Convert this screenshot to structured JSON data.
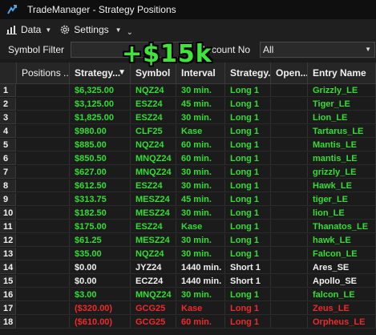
{
  "window": {
    "title": "TradeManager - Strategy Positions"
  },
  "toolbar": {
    "data_label": "Data",
    "settings_label": "Settings"
  },
  "filter": {
    "symbol_label": "Symbol Filter",
    "symbol_value": "",
    "account_label": "Account No",
    "account_value": "All"
  },
  "overlay": {
    "text": "+$15k"
  },
  "columns": [
    "Positions ...",
    "Strategy...",
    "Symbol",
    "Interval",
    "Strategy...",
    "Open...",
    "Entry Name"
  ],
  "colors": {
    "profit": "#33dd33",
    "neutral": "#f0f0f0",
    "loss": "#ee2a2a"
  },
  "rows": [
    {
      "num": "1",
      "pnl": "$6,325.00",
      "symbol": "NQZ24",
      "interval": "30 min.",
      "strategy": "Long 1",
      "open": "",
      "entry": "Grizzly_LE",
      "status": "green"
    },
    {
      "num": "2",
      "pnl": "$3,125.00",
      "symbol": "ESZ24",
      "interval": "45 min.",
      "strategy": "Long 1",
      "open": "",
      "entry": "Tiger_LE",
      "status": "green"
    },
    {
      "num": "3",
      "pnl": "$1,825.00",
      "symbol": "ESZ24",
      "interval": "30 min.",
      "strategy": "Long 1",
      "open": "",
      "entry": "Lion_LE",
      "status": "green"
    },
    {
      "num": "4",
      "pnl": "$980.00",
      "symbol": "CLF25",
      "interval": "Kase",
      "strategy": "Long 1",
      "open": "",
      "entry": "Tartarus_LE",
      "status": "green"
    },
    {
      "num": "5",
      "pnl": "$885.00",
      "symbol": "NQZ24",
      "interval": "60 min.",
      "strategy": "Long 1",
      "open": "",
      "entry": "Mantis_LE",
      "status": "green"
    },
    {
      "num": "6",
      "pnl": "$850.50",
      "symbol": "MNQZ24",
      "interval": "60 min.",
      "strategy": "Long 1",
      "open": "",
      "entry": "mantis_LE",
      "status": "green"
    },
    {
      "num": "7",
      "pnl": "$627.00",
      "symbol": "MNQZ24",
      "interval": "30 min.",
      "strategy": "Long 1",
      "open": "",
      "entry": "grizzly_LE",
      "status": "green"
    },
    {
      "num": "8",
      "pnl": "$612.50",
      "symbol": "ESZ24",
      "interval": "30 min.",
      "strategy": "Long 1",
      "open": "",
      "entry": "Hawk_LE",
      "status": "green"
    },
    {
      "num": "9",
      "pnl": "$313.75",
      "symbol": "MESZ24",
      "interval": "45 min.",
      "strategy": "Long 1",
      "open": "",
      "entry": "tiger_LE",
      "status": "green"
    },
    {
      "num": "10",
      "pnl": "$182.50",
      "symbol": "MESZ24",
      "interval": "30 min.",
      "strategy": "Long 1",
      "open": "",
      "entry": "lion_LE",
      "status": "green"
    },
    {
      "num": "11",
      "pnl": "$175.00",
      "symbol": "ESZ24",
      "interval": "Kase",
      "strategy": "Long 1",
      "open": "",
      "entry": "Thanatos_LE",
      "status": "green"
    },
    {
      "num": "12",
      "pnl": "$61.25",
      "symbol": "MESZ24",
      "interval": "30 min.",
      "strategy": "Long 1",
      "open": "",
      "entry": "hawk_LE",
      "status": "green"
    },
    {
      "num": "13",
      "pnl": "$35.00",
      "symbol": "NQZ24",
      "interval": "30 min.",
      "strategy": "Long 1",
      "open": "",
      "entry": "Falcon_LE",
      "status": "green"
    },
    {
      "num": "14",
      "pnl": "$0.00",
      "symbol": "JYZ24",
      "interval": "1440 min.",
      "strategy": "Short 1",
      "open": "",
      "entry": "Ares_SE",
      "status": "white"
    },
    {
      "num": "15",
      "pnl": "$0.00",
      "symbol": "ECZ24",
      "interval": "1440 min.",
      "strategy": "Short 1",
      "open": "",
      "entry": "Apollo_SE",
      "status": "white"
    },
    {
      "num": "16",
      "pnl": "$3.00",
      "symbol": "MNQZ24",
      "interval": "30 min.",
      "strategy": "Long 1",
      "open": "",
      "entry": "falcon_LE",
      "status": "green"
    },
    {
      "num": "17",
      "pnl": "($320.00)",
      "symbol": "GCG25",
      "interval": "Kase",
      "strategy": "Long 1",
      "open": "",
      "entry": "Zeus_LE",
      "status": "red"
    },
    {
      "num": "18",
      "pnl": "($610.00)",
      "symbol": "GCG25",
      "interval": "60 min.",
      "strategy": "Long 1",
      "open": "",
      "entry": "Orpheus_LE",
      "status": "red"
    }
  ]
}
